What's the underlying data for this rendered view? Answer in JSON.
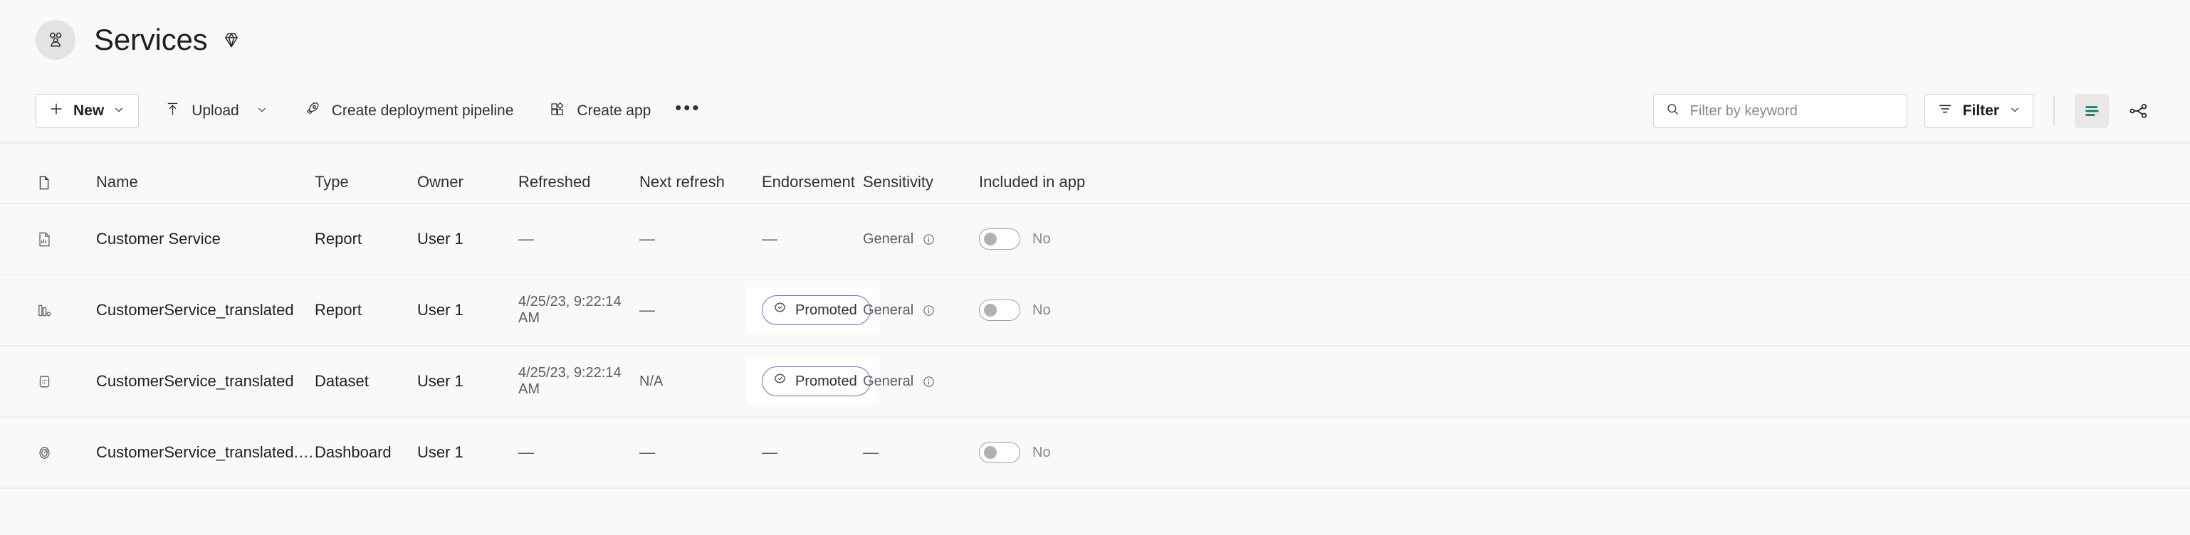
{
  "header": {
    "workspace_icon": "people-group-icon",
    "title": "Services",
    "premium_icon": "diamond-gem-icon"
  },
  "toolbar": {
    "new_label": "New",
    "upload_label": "Upload",
    "create_pipeline_label": "Create deployment pipeline",
    "create_app_label": "Create app",
    "overflow_label": "•••",
    "search": {
      "placeholder": "Filter by keyword",
      "value": ""
    },
    "filter_label": "Filter",
    "icons": {
      "new": "plus-icon",
      "new_chevron": "chevron-down-icon",
      "upload": "upload-arrow-icon",
      "upload_chevron": "chevron-down-icon",
      "create_pipeline": "rocket-icon",
      "create_app": "app-grid-icon",
      "search": "search-icon",
      "filter": "filter-lines-icon",
      "filter_chevron": "chevron-down-icon",
      "list_view": "list-view-icon",
      "lineage_view": "lineage-graph-icon"
    },
    "list_view_active": true,
    "accent_color": "#0f7364",
    "endorsement_border_color": "#6277c4"
  },
  "table": {
    "columns": [
      {
        "key": "icon",
        "label": "",
        "icon": "file-document-icon"
      },
      {
        "key": "name",
        "label": "Name"
      },
      {
        "key": "type",
        "label": "Type"
      },
      {
        "key": "owner",
        "label": "Owner"
      },
      {
        "key": "refreshed",
        "label": "Refreshed"
      },
      {
        "key": "next_refresh",
        "label": "Next refresh"
      },
      {
        "key": "endorsement",
        "label": "Endorsement"
      },
      {
        "key": "sensitivity",
        "label": "Sensitivity"
      },
      {
        "key": "included_in_app",
        "label": "Included in app"
      }
    ],
    "rows": [
      {
        "icon": "report-page-icon",
        "name": "Customer Service",
        "type": "Report",
        "owner": "User 1",
        "refreshed": "—",
        "next_refresh": "—",
        "endorsement": "—",
        "sensitivity": "General",
        "sensitivity_info_icon": "info-circle-icon",
        "included_in_app": "No",
        "included_in_app_toggle": "off"
      },
      {
        "icon": "bar-chart-report-icon",
        "name": "CustomerService_translated",
        "type": "Report",
        "owner": "User 1",
        "refreshed": "4/25/23, 9:22:14 AM",
        "next_refresh": "—",
        "endorsement": "Promoted",
        "endorsement_icon": "promoted-badge-icon",
        "sensitivity": "General",
        "sensitivity_info_icon": "info-circle-icon",
        "included_in_app": "No",
        "included_in_app_toggle": "off"
      },
      {
        "icon": "dataset-icon",
        "name": "CustomerService_translated",
        "type": "Dataset",
        "owner": "User 1",
        "refreshed": "4/25/23, 9:22:14 AM",
        "next_refresh": "N/A",
        "endorsement": "Promoted",
        "endorsement_icon": "promoted-badge-icon",
        "sensitivity": "General",
        "sensitivity_info_icon": "info-circle-icon",
        "included_in_app": "",
        "included_in_app_toggle": "none"
      },
      {
        "icon": "dashboard-gauge-icon",
        "name": "CustomerService_translated.pbix",
        "type": "Dashboard",
        "owner": "User 1",
        "refreshed": "—",
        "next_refresh": "—",
        "endorsement": "—",
        "sensitivity": "—",
        "included_in_app": "No",
        "included_in_app_toggle": "off"
      }
    ]
  }
}
